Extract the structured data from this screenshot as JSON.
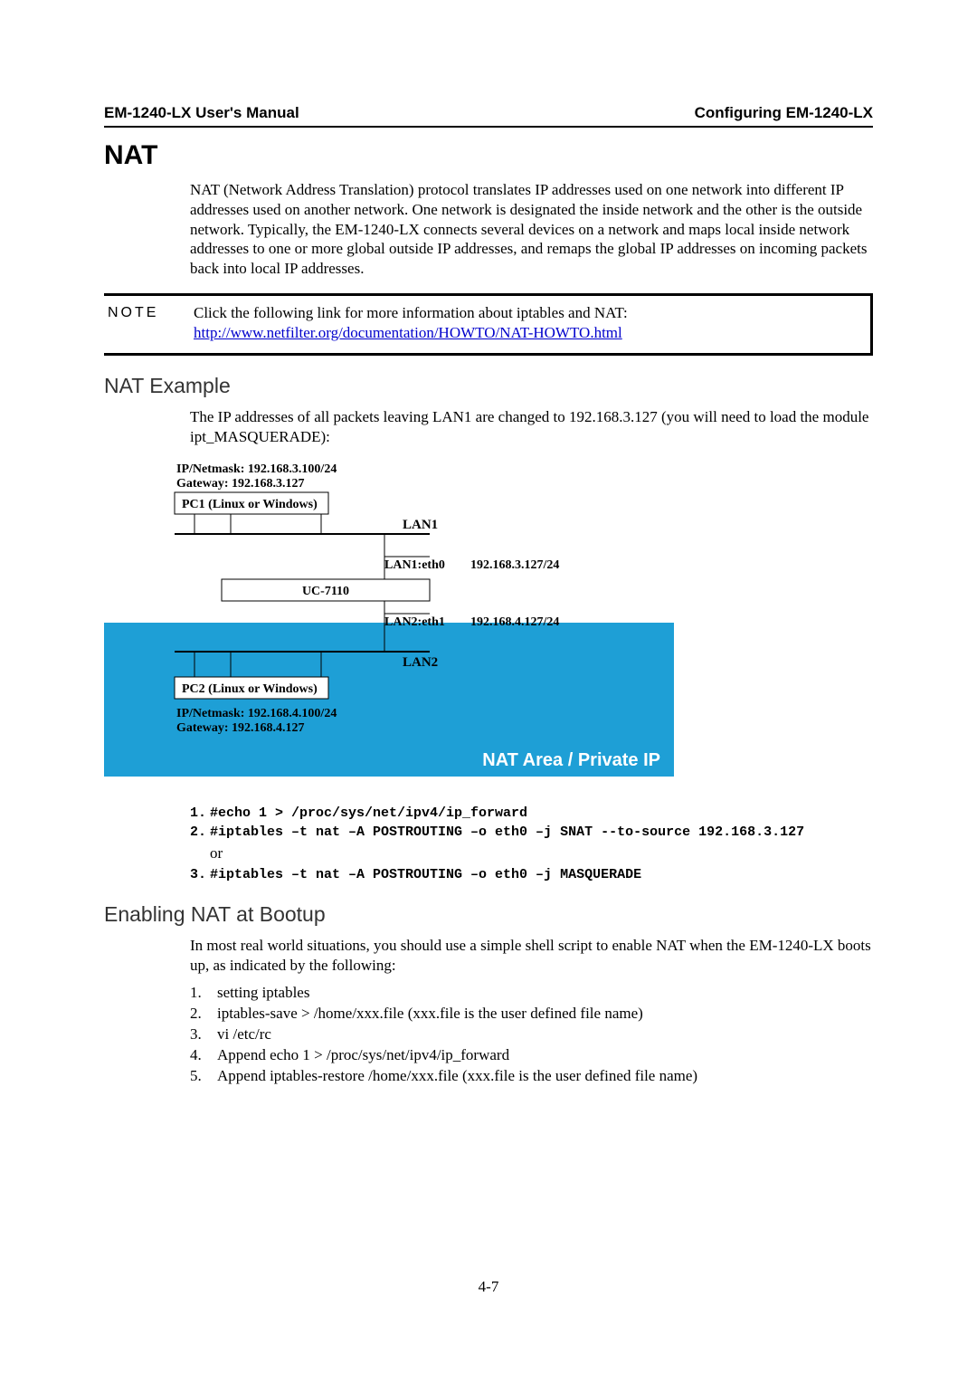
{
  "header": {
    "left": "EM-1240-LX User's Manual",
    "right": "Configuring EM-1240-LX"
  },
  "h1": "NAT",
  "nat_intro": "NAT (Network Address Translation) protocol translates IP addresses used on one network into different IP addresses used on another network. One network is designated the inside network and the other is the outside network. Typically, the EM-1240-LX connects several devices on a network and maps local inside network addresses to one or more global outside IP addresses, and remaps the global IP addresses on incoming packets back into local IP addresses.",
  "note": {
    "label": "NOTE",
    "text": "Click the following link for more information about iptables and NAT:",
    "link": "http://www.netfilter.org/documentation/HOWTO/NAT-HOWTO.html"
  },
  "h2_example": "NAT Example",
  "example_intro": "The IP addresses of all packets leaving LAN1 are changed to 192.168.3.127 (you will need to load the module ipt_MASQUERADE):",
  "diagram": {
    "pc1_ip": "IP/Netmask: 192.168.3.100/24",
    "pc1_gw": "Gateway:      192.168.3.127",
    "pc1_box": "PC1 (Linux or Windows)",
    "lan1": "LAN1",
    "lan1_eth": "LAN1:eth0",
    "lan1_ip": "192.168.3.127/24",
    "uc": "UC-7110",
    "lan2_eth": "LAN2:eth1",
    "lan2_ip": "192.168.4.127/24",
    "lan2": "LAN2",
    "pc2_box": "PC2 (Linux or Windows)",
    "pc2_ip": "IP/Netmask: 192.168.4.100/24",
    "pc2_gw": "Gateway:      192.168.4.127",
    "nat_area": "NAT Area / Private IP"
  },
  "commands": {
    "c1": "#echo 1 > /proc/sys/net/ipv4/ip_forward",
    "c2": "#iptables –t nat –A POSTROUTING –o eth0 –j SNAT --to-source 192.168.3.127",
    "or": "or",
    "c3": "#iptables –t nat –A POSTROUTING –o eth0 –j MASQUERADE"
  },
  "h2_bootup": "Enabling NAT at Bootup",
  "bootup_intro": "In most real world situations, you should use a simple shell script to enable NAT when the EM-1240-LX boots up, as indicated by the following:",
  "steps": {
    "s1": "setting iptables",
    "s2": "iptables-save > /home/xxx.file (xxx.file is the user defined file name)",
    "s3": "vi /etc/rc",
    "s4": "Append   echo 1 > /proc/sys/net/ipv4/ip_forward",
    "s5": "Append   iptables-restore /home/xxx.file (xxx.file is the user defined file name)"
  },
  "page_number": "4-7"
}
